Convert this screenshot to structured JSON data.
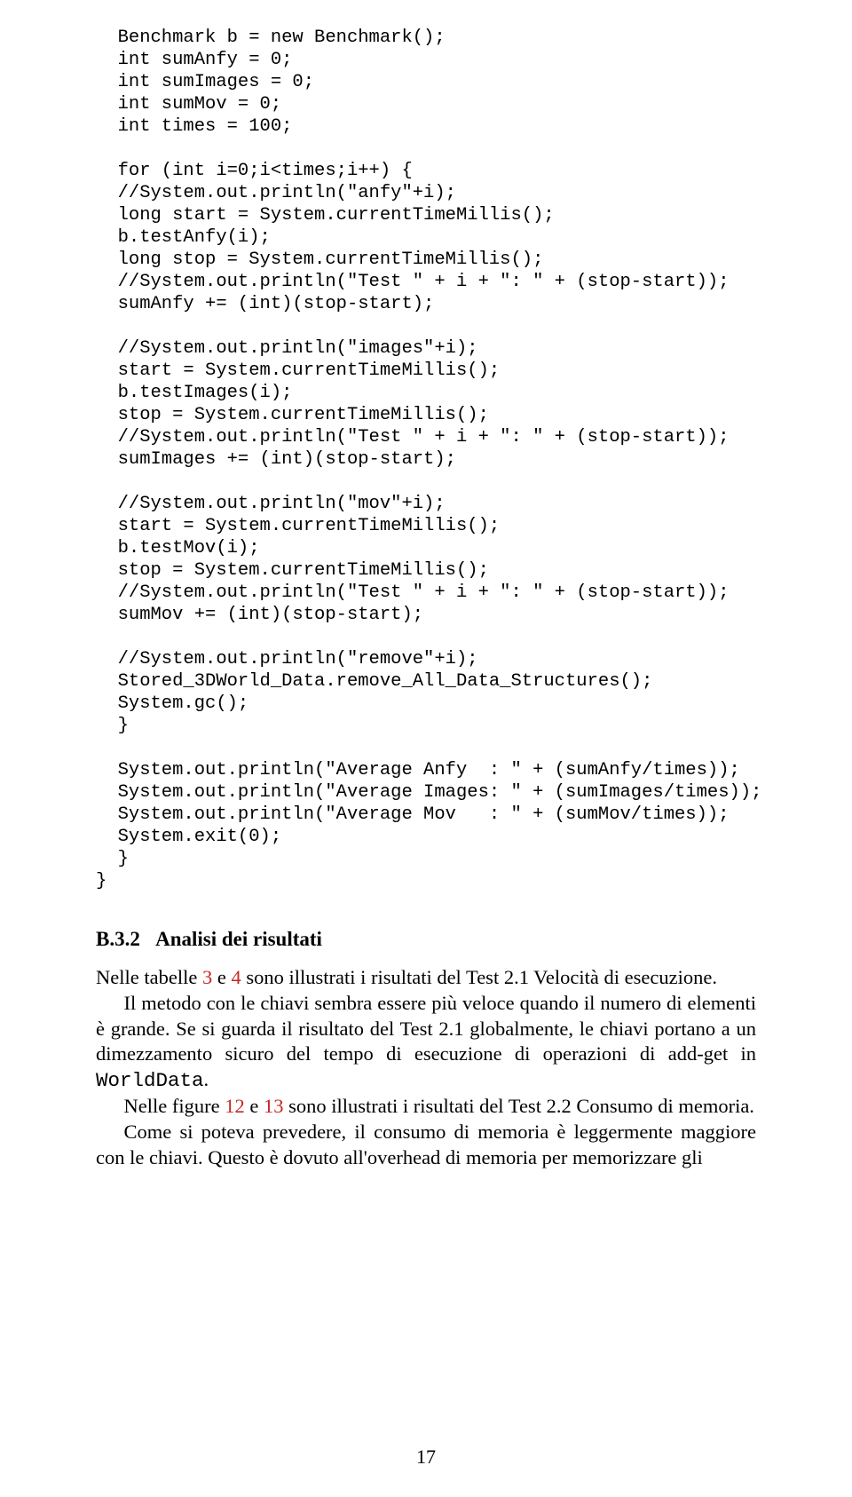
{
  "code": {
    "l01": "  Benchmark b = new Benchmark();",
    "l02": "  int sumAnfy = 0;",
    "l03": "  int sumImages = 0;",
    "l04": "  int sumMov = 0;",
    "l05": "  int times = 100;",
    "l06": "",
    "l07": "  for (int i=0;i<times;i++) {",
    "l08": "  //System.out.println(\"anfy\"+i);",
    "l09": "  long start = System.currentTimeMillis();",
    "l10": "  b.testAnfy(i);",
    "l11": "  long stop = System.currentTimeMillis();",
    "l12": "  //System.out.println(\"Test \" + i + \": \" + (stop-start));",
    "l13": "  sumAnfy += (int)(stop-start);",
    "l14": "",
    "l15": "  //System.out.println(\"images\"+i);",
    "l16": "  start = System.currentTimeMillis();",
    "l17": "  b.testImages(i);",
    "l18": "  stop = System.currentTimeMillis();",
    "l19": "  //System.out.println(\"Test \" + i + \": \" + (stop-start));",
    "l20": "  sumImages += (int)(stop-start);",
    "l21": "",
    "l22": "  //System.out.println(\"mov\"+i);",
    "l23": "  start = System.currentTimeMillis();",
    "l24": "  b.testMov(i);",
    "l25": "  stop = System.currentTimeMillis();",
    "l26": "  //System.out.println(\"Test \" + i + \": \" + (stop-start));",
    "l27": "  sumMov += (int)(stop-start);",
    "l28": "",
    "l29": "  //System.out.println(\"remove\"+i);",
    "l30": "  Stored_3DWorld_Data.remove_All_Data_Structures();",
    "l31": "  System.gc();",
    "l32": "  }",
    "l33": "",
    "l34": "  System.out.println(\"Average Anfy  : \" + (sumAnfy/times));",
    "l35": "  System.out.println(\"Average Images: \" + (sumImages/times));",
    "l36": "  System.out.println(\"Average Mov   : \" + (sumMov/times));",
    "l37": "  System.exit(0);",
    "l38": "  }",
    "l39": "}"
  },
  "section": {
    "number": "B.3.2",
    "title": "Analisi dei risultati"
  },
  "body": {
    "p1a": "Nelle tabelle ",
    "ref3": "3",
    "p1b": " e ",
    "ref4": "4",
    "p1c": " sono illustrati i risultati del Test 2.1 Velocità di esecuzione.",
    "p2": "Il metodo con le chiavi sembra essere più veloce quando il numero di elementi è grande. Se si guarda il risultato del Test 2.1 globalmente, le chiavi portano a un dimezzamento sicuro del tempo di esecuzione di operazioni di add-get in ",
    "p2mono": "WorldData",
    "p2end": ".",
    "p3a": "Nelle figure ",
    "ref12": "12",
    "p3b": " e ",
    "ref13": "13",
    "p3c": " sono illustrati i risultati del Test 2.2 Consumo di memoria.",
    "p4": "Come si poteva prevedere, il consumo di memoria è leggermente maggiore con le chiavi.  Questo è dovuto all'overhead di memoria per memorizzare gli"
  },
  "pageNumber": "17"
}
